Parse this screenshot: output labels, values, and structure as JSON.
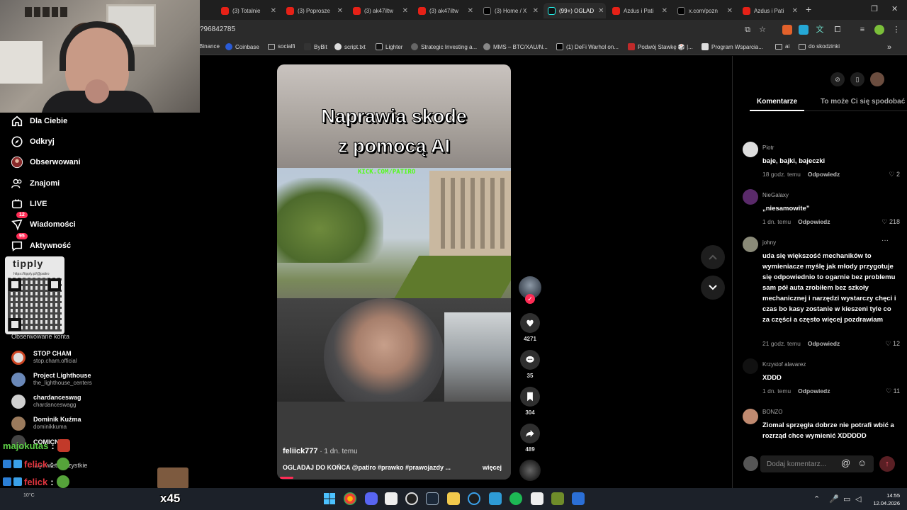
{
  "browser": {
    "tabs": [
      {
        "title": "(3) Totalnie",
        "icon": "youtube-icon"
      },
      {
        "title": "(3) Poprosze",
        "icon": "youtube-icon"
      },
      {
        "title": "(3) ak47iltw",
        "icon": "youtube-icon"
      },
      {
        "title": "(3) ak47iltw",
        "icon": "youtube-icon"
      },
      {
        "title": "(3) Home / X",
        "icon": "x-icon"
      },
      {
        "title": "(99+) OGLAD",
        "icon": "tiktok-icon",
        "active": true
      },
      {
        "title": "Azdus i Pati",
        "icon": "youtube-icon"
      },
      {
        "title": "x.com/pozn",
        "icon": "x-icon"
      },
      {
        "title": "Azdus i Pati",
        "icon": "youtube-icon"
      }
    ],
    "url": "?96842785",
    "bookmarks": [
      "Binance",
      "Coinbase",
      "socialfi",
      "ByBit",
      "script.txt",
      "Lighter",
      "Strategic Investing a...",
      "MMS – BTC/XAU/N...",
      "(1) DeFi Warhol on...",
      "Podwój Stawkę 🎲 |...",
      "Program Wsparcia...",
      "ai",
      "do skodzinki"
    ]
  },
  "sidebar": {
    "nav": [
      {
        "label": "Dla Ciebie",
        "icon": "home-icon"
      },
      {
        "label": "Odkryj",
        "icon": "compass-icon"
      },
      {
        "label": "Obserwowani",
        "icon": "following-icon"
      },
      {
        "label": "Znajomi",
        "icon": "friends-icon"
      },
      {
        "label": "LIVE",
        "icon": "live-icon"
      },
      {
        "label": "Wiadomości",
        "icon": "messages-icon",
        "badge": "12"
      },
      {
        "label": "Aktywność",
        "icon": "activity-icon",
        "badge": "95"
      }
    ],
    "qr": {
      "title": "tipply",
      "subtitle": "https://tipply.pl/@patiro"
    },
    "followed_heading": "Obserwowane konta",
    "accounts": [
      {
        "name": "STOP CHAM",
        "handle": "stop.cham.official"
      },
      {
        "name": "Project Lighthouse",
        "handle": "the_lighthouse_centers"
      },
      {
        "name": "chardanceswag",
        "handle": "chardanceswagg"
      },
      {
        "name": "Dominik Kuźma",
        "handle": "dominikkuma"
      },
      {
        "name": "COMICNU...",
        "handle": ""
      }
    ],
    "see_more": "Wyświetl wszystkie"
  },
  "chat": [
    {
      "name": "majokutas",
      "color": "green"
    },
    {
      "name": "felick",
      "color": "red"
    },
    {
      "name": "felick",
      "color": "red"
    },
    {
      "name": "felick",
      "color": "red"
    }
  ],
  "overlay": {
    "multiplier": "x45",
    "weather": "10°C"
  },
  "video": {
    "title_line1": "Naprawia skode",
    "title_line2": "z pomocą AI",
    "watermark": "KICK.COM/PATIRO",
    "author": "feliick777",
    "posted": " · 1 dn. temu",
    "description": "OGLADAJ DO KOŃCA @patiro #prawko #prawojazdy ...",
    "more": "więcej",
    "progress_fraction": 0.06
  },
  "actions": {
    "likes": "4271",
    "comments": "35",
    "saves": "304",
    "shares": "489"
  },
  "comments_panel": {
    "tab_active": "Komentarze",
    "tab_other": "To może Ci się spodobać",
    "comments": [
      {
        "user": "Piotr",
        "text": "baje, bajki, bajeczki",
        "time": "18 godz. temu",
        "reply": "Odpowiedz",
        "likes": "2"
      },
      {
        "user": "NieGalaxy",
        "text": "„niesamowite”",
        "time": "1 dn. temu",
        "reply": "Odpowiedz",
        "likes": "218"
      },
      {
        "user": "johny",
        "text": "uda się większość mechaników to wymieniacze myślę jak młody przygotuje się odpowiednio to ogarnie bez problemu sam pół auta zrobiłem bez szkoły mechanicznej i narzędzi wystarczy chęci i czas bo kasy zostanie w kieszeni tyle co za części a często więcej pozdrawiam",
        "time": "21 godz. temu",
        "reply": "Odpowiedz",
        "likes": "12"
      },
      {
        "user": "Krzystof alavarez",
        "text": "XDDD",
        "time": "1 dn. temu",
        "reply": "Odpowiedz",
        "likes": "11"
      },
      {
        "user": "BONZO",
        "text": "Ziomal sprzęgła dobrze nie potrafi wbić a rozrząd chce wymienić XDDDDD",
        "time": "",
        "reply": "",
        "likes": ""
      }
    ],
    "input_placeholder": "Dodaj komentarz..."
  },
  "taskbar": {
    "time": "14:55",
    "date": "12.04.2026"
  }
}
